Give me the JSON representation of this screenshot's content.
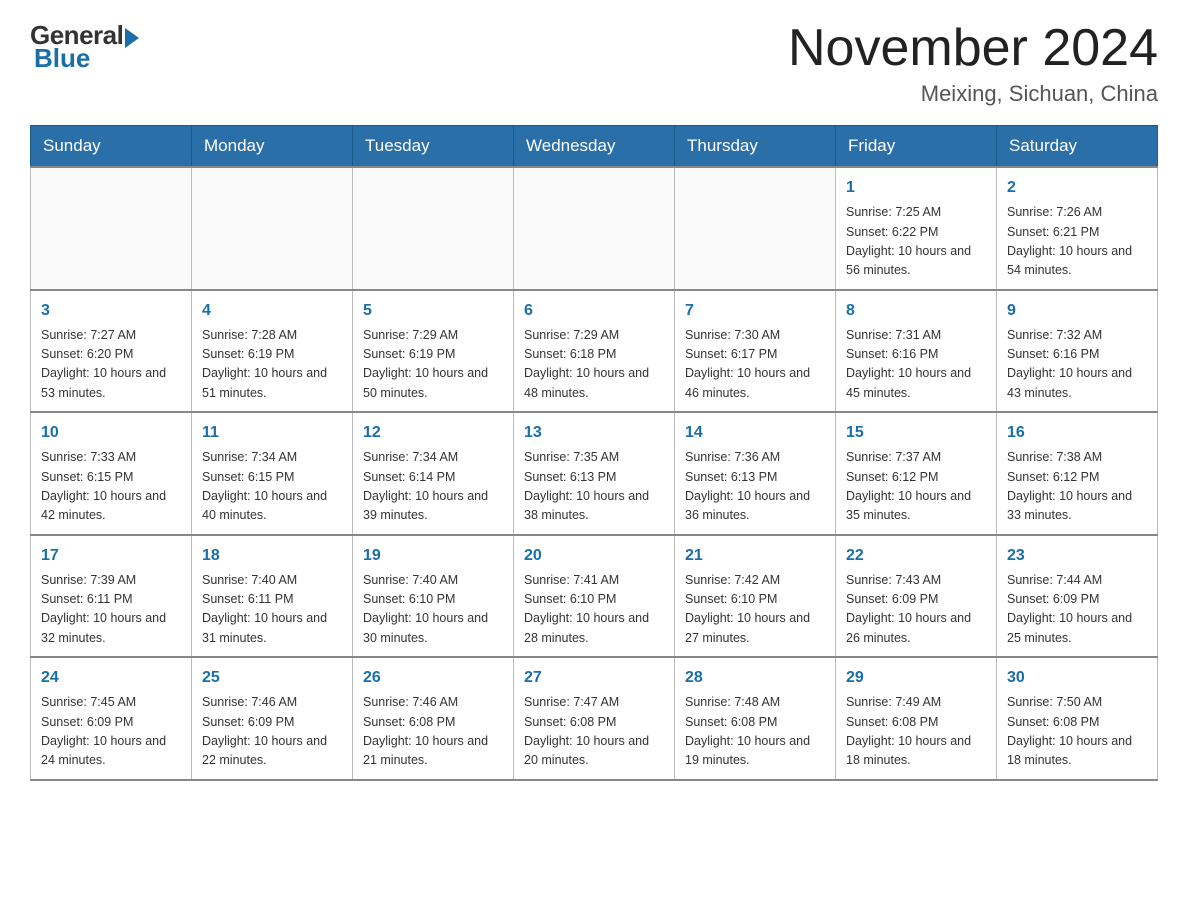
{
  "header": {
    "logo_general": "General",
    "logo_blue": "Blue",
    "month_title": "November 2024",
    "location": "Meixing, Sichuan, China"
  },
  "weekdays": [
    "Sunday",
    "Monday",
    "Tuesday",
    "Wednesday",
    "Thursday",
    "Friday",
    "Saturday"
  ],
  "weeks": [
    [
      {
        "day": "",
        "info": ""
      },
      {
        "day": "",
        "info": ""
      },
      {
        "day": "",
        "info": ""
      },
      {
        "day": "",
        "info": ""
      },
      {
        "day": "",
        "info": ""
      },
      {
        "day": "1",
        "info": "Sunrise: 7:25 AM\nSunset: 6:22 PM\nDaylight: 10 hours and 56 minutes."
      },
      {
        "day": "2",
        "info": "Sunrise: 7:26 AM\nSunset: 6:21 PM\nDaylight: 10 hours and 54 minutes."
      }
    ],
    [
      {
        "day": "3",
        "info": "Sunrise: 7:27 AM\nSunset: 6:20 PM\nDaylight: 10 hours and 53 minutes."
      },
      {
        "day": "4",
        "info": "Sunrise: 7:28 AM\nSunset: 6:19 PM\nDaylight: 10 hours and 51 minutes."
      },
      {
        "day": "5",
        "info": "Sunrise: 7:29 AM\nSunset: 6:19 PM\nDaylight: 10 hours and 50 minutes."
      },
      {
        "day": "6",
        "info": "Sunrise: 7:29 AM\nSunset: 6:18 PM\nDaylight: 10 hours and 48 minutes."
      },
      {
        "day": "7",
        "info": "Sunrise: 7:30 AM\nSunset: 6:17 PM\nDaylight: 10 hours and 46 minutes."
      },
      {
        "day": "8",
        "info": "Sunrise: 7:31 AM\nSunset: 6:16 PM\nDaylight: 10 hours and 45 minutes."
      },
      {
        "day": "9",
        "info": "Sunrise: 7:32 AM\nSunset: 6:16 PM\nDaylight: 10 hours and 43 minutes."
      }
    ],
    [
      {
        "day": "10",
        "info": "Sunrise: 7:33 AM\nSunset: 6:15 PM\nDaylight: 10 hours and 42 minutes."
      },
      {
        "day": "11",
        "info": "Sunrise: 7:34 AM\nSunset: 6:15 PM\nDaylight: 10 hours and 40 minutes."
      },
      {
        "day": "12",
        "info": "Sunrise: 7:34 AM\nSunset: 6:14 PM\nDaylight: 10 hours and 39 minutes."
      },
      {
        "day": "13",
        "info": "Sunrise: 7:35 AM\nSunset: 6:13 PM\nDaylight: 10 hours and 38 minutes."
      },
      {
        "day": "14",
        "info": "Sunrise: 7:36 AM\nSunset: 6:13 PM\nDaylight: 10 hours and 36 minutes."
      },
      {
        "day": "15",
        "info": "Sunrise: 7:37 AM\nSunset: 6:12 PM\nDaylight: 10 hours and 35 minutes."
      },
      {
        "day": "16",
        "info": "Sunrise: 7:38 AM\nSunset: 6:12 PM\nDaylight: 10 hours and 33 minutes."
      }
    ],
    [
      {
        "day": "17",
        "info": "Sunrise: 7:39 AM\nSunset: 6:11 PM\nDaylight: 10 hours and 32 minutes."
      },
      {
        "day": "18",
        "info": "Sunrise: 7:40 AM\nSunset: 6:11 PM\nDaylight: 10 hours and 31 minutes."
      },
      {
        "day": "19",
        "info": "Sunrise: 7:40 AM\nSunset: 6:10 PM\nDaylight: 10 hours and 30 minutes."
      },
      {
        "day": "20",
        "info": "Sunrise: 7:41 AM\nSunset: 6:10 PM\nDaylight: 10 hours and 28 minutes."
      },
      {
        "day": "21",
        "info": "Sunrise: 7:42 AM\nSunset: 6:10 PM\nDaylight: 10 hours and 27 minutes."
      },
      {
        "day": "22",
        "info": "Sunrise: 7:43 AM\nSunset: 6:09 PM\nDaylight: 10 hours and 26 minutes."
      },
      {
        "day": "23",
        "info": "Sunrise: 7:44 AM\nSunset: 6:09 PM\nDaylight: 10 hours and 25 minutes."
      }
    ],
    [
      {
        "day": "24",
        "info": "Sunrise: 7:45 AM\nSunset: 6:09 PM\nDaylight: 10 hours and 24 minutes."
      },
      {
        "day": "25",
        "info": "Sunrise: 7:46 AM\nSunset: 6:09 PM\nDaylight: 10 hours and 22 minutes."
      },
      {
        "day": "26",
        "info": "Sunrise: 7:46 AM\nSunset: 6:08 PM\nDaylight: 10 hours and 21 minutes."
      },
      {
        "day": "27",
        "info": "Sunrise: 7:47 AM\nSunset: 6:08 PM\nDaylight: 10 hours and 20 minutes."
      },
      {
        "day": "28",
        "info": "Sunrise: 7:48 AM\nSunset: 6:08 PM\nDaylight: 10 hours and 19 minutes."
      },
      {
        "day": "29",
        "info": "Sunrise: 7:49 AM\nSunset: 6:08 PM\nDaylight: 10 hours and 18 minutes."
      },
      {
        "day": "30",
        "info": "Sunrise: 7:50 AM\nSunset: 6:08 PM\nDaylight: 10 hours and 18 minutes."
      }
    ]
  ]
}
